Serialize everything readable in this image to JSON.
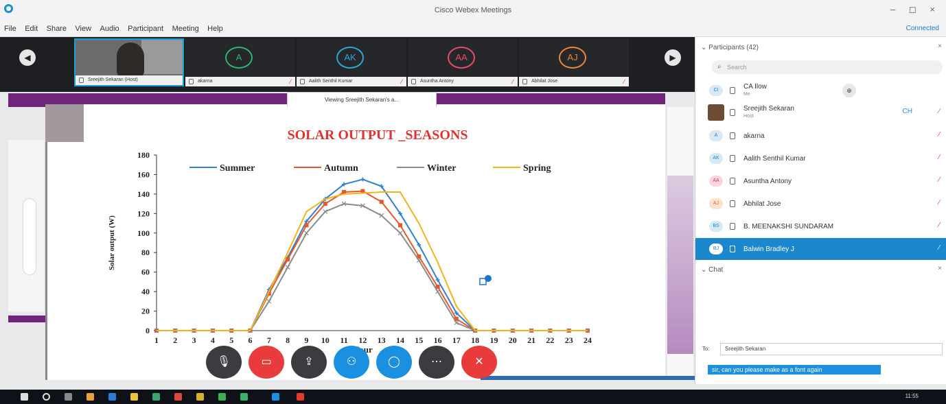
{
  "window": {
    "title": "Cisco Webex Meetings",
    "controls": "– ◻ ×"
  },
  "menu": [
    "File",
    "Edit",
    "Share",
    "View",
    "Audio",
    "Participant",
    "Meeting",
    "Help"
  ],
  "status": {
    "connected": "Connected"
  },
  "strip": {
    "tiles": [
      {
        "initials": "",
        "name": "Sreejith Sekaran (Host)",
        "color": "#1aa5dc"
      },
      {
        "initials": "A",
        "name": "akarna",
        "color": "#2bb673"
      },
      {
        "initials": "AK",
        "name": "Aalith Senthil Kumar",
        "color": "#2aa9d8"
      },
      {
        "initials": "AA",
        "name": "Asuntha Antony",
        "color": "#e64c6f"
      },
      {
        "initials": "AJ",
        "name": "Abhilat Jose",
        "color": "#f0843a"
      }
    ]
  },
  "share": {
    "viewing_label": "Viewing Sreejith Sekaran's a..."
  },
  "chart_data": {
    "type": "line",
    "title": "SOLAR OUTPUT _SEASONS",
    "xlabel": "Hour",
    "ylabel": "Solar output (W)",
    "ylim": [
      0,
      180
    ],
    "yticks": [
      0,
      20,
      40,
      60,
      80,
      100,
      120,
      140,
      160,
      180
    ],
    "x": [
      1,
      2,
      3,
      4,
      5,
      6,
      7,
      8,
      9,
      10,
      11,
      12,
      13,
      14,
      15,
      16,
      17,
      18,
      19,
      20,
      21,
      22,
      23,
      24
    ],
    "legend_position": "top",
    "series": [
      {
        "name": "Summer",
        "color": "#2f7fd3",
        "marker": "plus",
        "values": [
          0,
          0,
          0,
          0,
          0,
          0,
          42,
          75,
          112,
          135,
          150,
          155,
          148,
          120,
          88,
          52,
          18,
          0,
          0,
          0,
          0,
          0,
          0,
          0
        ]
      },
      {
        "name": "Autumn",
        "color": "#e4582a",
        "marker": "square",
        "values": [
          0,
          0,
          0,
          0,
          0,
          0,
          38,
          73,
          108,
          130,
          142,
          143,
          132,
          108,
          76,
          45,
          12,
          0,
          0,
          0,
          0,
          0,
          0,
          0
        ]
      },
      {
        "name": "Winter",
        "color": "#8a8a8a",
        "marker": "x",
        "values": [
          0,
          0,
          0,
          0,
          0,
          0,
          30,
          65,
          100,
          122,
          130,
          128,
          118,
          100,
          72,
          40,
          8,
          0,
          0,
          0,
          0,
          0,
          0,
          0
        ]
      },
      {
        "name": "Spring",
        "color": "#f2b21c",
        "marker": "none",
        "values": [
          0,
          0,
          0,
          0,
          0,
          0,
          40,
          80,
          122,
          135,
          140,
          141,
          142,
          142,
          110,
          70,
          25,
          0,
          0,
          0,
          0,
          0,
          0,
          0
        ]
      }
    ]
  },
  "controls": {
    "buttons": [
      {
        "name": "mute-button",
        "icon": "mic-icon",
        "color": "#3c3c40"
      },
      {
        "name": "stop-video-button",
        "icon": "camera-icon",
        "color": "#e83b3b"
      },
      {
        "name": "share-button",
        "icon": "share-icon",
        "color": "#3c3c40"
      },
      {
        "name": "participants-button",
        "icon": "person-icon",
        "color": "#1b8fe0"
      },
      {
        "name": "chat-button",
        "icon": "chat-icon",
        "color": "#1b8fe0"
      },
      {
        "name": "more-button",
        "icon": "more-icon",
        "color": "#3c3c40"
      },
      {
        "name": "leave-button",
        "icon": "close-icon",
        "color": "#e83b3b"
      }
    ]
  },
  "participants": {
    "header": "Participants (42)",
    "search_placeholder": "Search",
    "list": [
      {
        "initials": "CI",
        "name": "CA Ilow",
        "sub": "Me",
        "color": "#6fb3e0",
        "muted": false,
        "cohost": true
      },
      {
        "initials": "",
        "name": "Sreejith Sekaran",
        "sub": "Host",
        "color": "#6d4b35",
        "muted": false,
        "photo": true,
        "extra": "CH"
      },
      {
        "initials": "A",
        "name": "akarna",
        "sub": "",
        "color": "#6fb3e0",
        "muted": true
      },
      {
        "initials": "AK",
        "name": "Aalith Senthil Kumar",
        "sub": "",
        "color": "#6fb3e0",
        "muted": true
      },
      {
        "initials": "AA",
        "name": "Asuntha Antony",
        "sub": "",
        "color": "#e88aa0",
        "muted": true
      },
      {
        "initials": "AJ",
        "name": "Abhilat Jose",
        "sub": "",
        "color": "#f0a06a",
        "muted": true
      },
      {
        "initials": "BS",
        "name": "B. MEENAKSHI SUNDARAM",
        "sub": "",
        "color": "#6fb3e0",
        "muted": true
      },
      {
        "initials": "BJ",
        "name": "Balwin Bradley J",
        "sub": "",
        "color": "#ffffff",
        "muted": true,
        "selected": true
      }
    ]
  },
  "chat": {
    "header": "Chat",
    "to_label": "To:",
    "to_value": "Sreejith Sekaran",
    "input_value": "sir, can you please make as a font again"
  },
  "taskbar": {
    "time": "11:55"
  }
}
